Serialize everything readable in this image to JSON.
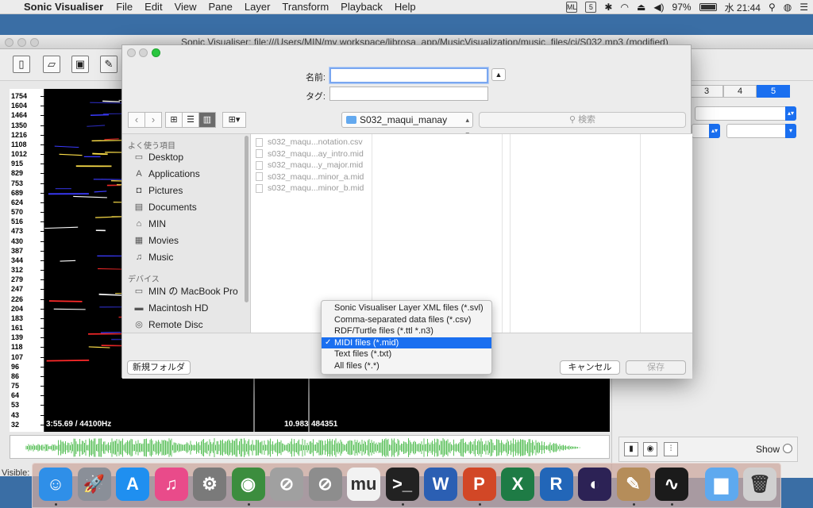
{
  "menubar": {
    "app_name": "Sonic Visualiser",
    "items": [
      "File",
      "Edit",
      "View",
      "Pane",
      "Layer",
      "Transform",
      "Playback",
      "Help"
    ],
    "battery": "97%",
    "clock": "水 21:44",
    "status_icons": [
      "ML",
      "5",
      "bluetooth",
      "wifi",
      "eject",
      "volume"
    ]
  },
  "main_window": {
    "title": "Sonic Visualiser: file:///Users/MIN/my workspace/librosa_app/MusicVisualization/music_files/ci/S032.mp3 (modified)",
    "freq_ticks": [
      "1754",
      "1604",
      "1464",
      "1350",
      "1216",
      "1108",
      "1012",
      "915",
      "829",
      "753",
      "689",
      "624",
      "570",
      "516",
      "473",
      "430",
      "387",
      "344",
      "312",
      "279",
      "247",
      "226",
      "204",
      "183",
      "161",
      "139",
      "118",
      "107",
      "96",
      "86",
      "75",
      "64",
      "53",
      "43",
      "32"
    ],
    "readout_left": "3:55.69 / 44100Hz",
    "readout_mid": "10.983",
    "readout_right": "484351",
    "visible_label": "Visible:",
    "tabs": [
      "3",
      "4",
      "5"
    ],
    "show_label": "Show"
  },
  "dialog": {
    "name_label": "名前:",
    "name_value": "",
    "tag_label": "タグ:",
    "tag_value": "",
    "current_folder": "S032_maqui_manay",
    "search_placeholder": "検索",
    "sidebar": {
      "favorites_header": "よく使う項目",
      "favorites": [
        {
          "label": "Desktop",
          "icon": "desktop-icon"
        },
        {
          "label": "Applications",
          "icon": "applications-icon"
        },
        {
          "label": "Pictures",
          "icon": "camera-icon"
        },
        {
          "label": "Documents",
          "icon": "documents-icon"
        },
        {
          "label": "MIN",
          "icon": "home-icon"
        },
        {
          "label": "Movies",
          "icon": "film-icon"
        },
        {
          "label": "Music",
          "icon": "music-note-icon"
        }
      ],
      "devices_header": "デバイス",
      "devices": [
        {
          "label": "MIN の MacBook Pro",
          "icon": "laptop-icon"
        },
        {
          "label": "Macintosh HD",
          "icon": "harddisk-icon"
        },
        {
          "label": "Remote Disc",
          "icon": "disc-icon"
        }
      ]
    },
    "files": [
      "s032_maqu...notation.csv",
      "s032_maqu...ay_intro.mid",
      "s032_maqu...y_major.mid",
      "s032_maqu...minor_a.mid",
      "s032_maqu...minor_b.mid"
    ],
    "new_folder_label": "新規フォルダ",
    "cancel_label": "キャンセル",
    "save_label": "保存",
    "file_type_options": [
      "Sonic Visualiser Layer XML files (*.svl)",
      "Comma-separated data files (*.csv)",
      "RDF/Turtle files (*.ttl *.n3)",
      "MIDI files (*.mid)",
      "Text files (*.txt)",
      "All files (*.*)"
    ],
    "file_type_selected_index": 3
  },
  "dock": {
    "apps": [
      {
        "name": "finder",
        "glyph": "☺",
        "color": "#2f8fe8"
      },
      {
        "name": "launchpad",
        "glyph": "🚀",
        "color": "#8a8f98"
      },
      {
        "name": "app-store",
        "glyph": "A",
        "color": "#1f8ff0"
      },
      {
        "name": "itunes",
        "glyph": "♫",
        "color": "#e94b8a"
      },
      {
        "name": "system-preferences",
        "glyph": "⚙",
        "color": "#7a7a7a"
      },
      {
        "name": "chrome",
        "glyph": "◉",
        "color": "#3c8d3e"
      },
      {
        "name": "prohibited-app-1",
        "glyph": "⊘",
        "color": "#a0a0a0"
      },
      {
        "name": "prohibited-app-2",
        "glyph": "⊘",
        "color": "#8d8d8d"
      },
      {
        "name": "mu",
        "glyph": "mu",
        "color": "#f2f2f2"
      },
      {
        "name": "terminal",
        "glyph": ">_",
        "color": "#222222"
      },
      {
        "name": "word",
        "glyph": "W",
        "color": "#2b5fb3"
      },
      {
        "name": "powerpoint",
        "glyph": "P",
        "color": "#d24726"
      },
      {
        "name": "excel",
        "glyph": "X",
        "color": "#1e7b45"
      },
      {
        "name": "r",
        "glyph": "R",
        "color": "#2266b8"
      },
      {
        "name": "eclipse",
        "glyph": "◐",
        "color": "#2c2255"
      },
      {
        "name": "preview",
        "glyph": "✎",
        "color": "#b58d5a"
      },
      {
        "name": "sonic-visualiser",
        "glyph": "∿",
        "color": "#1b1b1b"
      },
      {
        "name": "downloads-folder",
        "glyph": "▆",
        "color": "#5ea9ef"
      },
      {
        "name": "trash",
        "glyph": "🗑",
        "color": "#d0d0d0"
      }
    ]
  }
}
